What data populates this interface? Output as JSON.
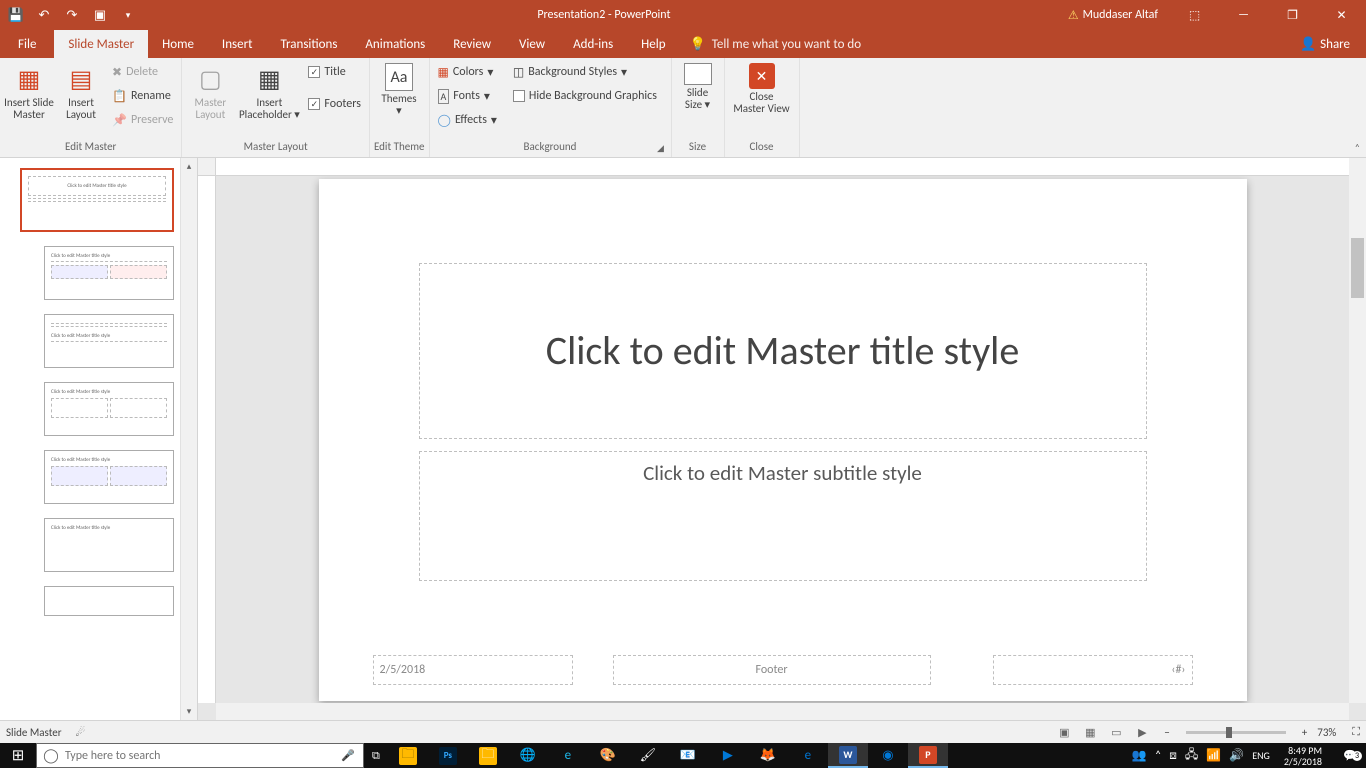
{
  "title": "Presentation2  -  PowerPoint",
  "user": "Muddaser Altaf",
  "tabs": {
    "file": "File",
    "slidemaster": "Slide Master",
    "home": "Home",
    "insert": "Insert",
    "transitions": "Transitions",
    "animations": "Animations",
    "review": "Review",
    "view": "View",
    "addins": "Add-ins",
    "help": "Help"
  },
  "tellme": "Tell me what you want to do",
  "share": "Share",
  "ribbon": {
    "editmaster": {
      "label": "Edit Master",
      "insertslidemaster": "Insert Slide\nMaster",
      "insertlayout": "Insert\nLayout",
      "delete": "Delete",
      "rename": "Rename",
      "preserve": "Preserve"
    },
    "masterlayout": {
      "label": "Master Layout",
      "masterlayoutbtn": "Master\nLayout",
      "insertplaceholder": "Insert\nPlaceholder",
      "title_chk": "Title",
      "footers_chk": "Footers"
    },
    "edittheme": {
      "label": "Edit Theme",
      "themes": "Themes"
    },
    "background": {
      "label": "Background",
      "colors": "Colors",
      "fonts": "Fonts",
      "effects": "Effects",
      "bgstyles": "Background Styles",
      "hidebg": "Hide Background Graphics"
    },
    "size": {
      "label": "Size",
      "slidesize": "Slide\nSize"
    },
    "close": {
      "label": "Close",
      "closemaster": "Close\nMaster View"
    }
  },
  "slide": {
    "title": "Click to edit Master title style",
    "subtitle": "Click to edit Master subtitle style",
    "date": "2/5/2018",
    "footer": "Footer",
    "num": "‹#›"
  },
  "thumb_text": "Click to edit Master title style",
  "status": {
    "mode": "Slide Master",
    "zoom": "73%"
  },
  "search_placeholder": "Type here to search",
  "clock": {
    "time": "8:49 PM",
    "date": "2/5/2018"
  },
  "notif_count": "3"
}
